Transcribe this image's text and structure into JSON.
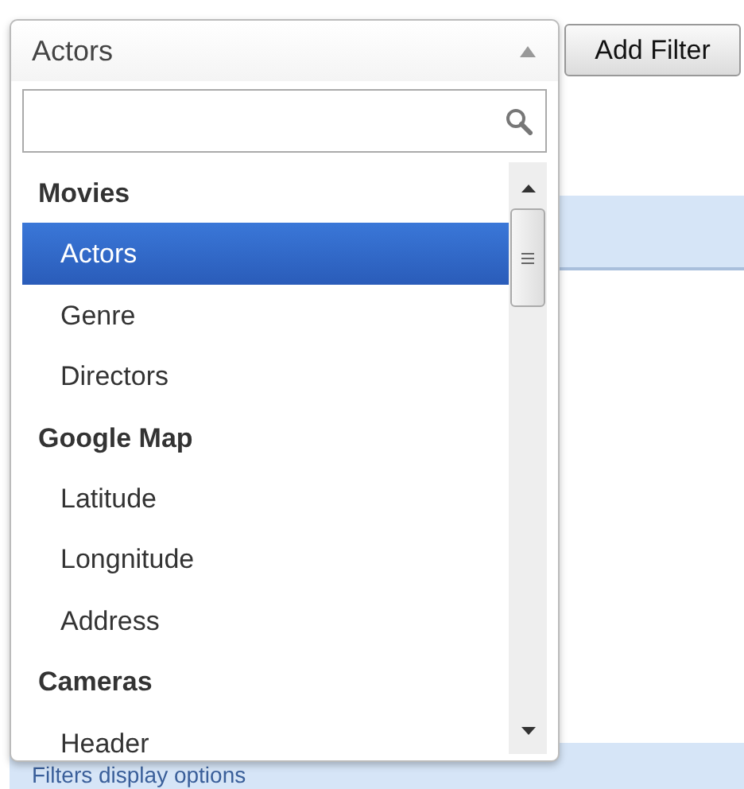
{
  "select": {
    "value": "Actors",
    "expanded": true
  },
  "add_filter_button": {
    "label": "Add Filter"
  },
  "groups": [
    {
      "label": "Movies",
      "options": [
        {
          "label": "Actors",
          "selected": true
        },
        {
          "label": "Genre",
          "selected": false
        },
        {
          "label": "Directors",
          "selected": false
        }
      ]
    },
    {
      "label": "Google Map",
      "options": [
        {
          "label": "Latitude",
          "selected": false
        },
        {
          "label": "Longnitude",
          "selected": false
        },
        {
          "label": "Address",
          "selected": false
        }
      ]
    },
    {
      "label": "Cameras",
      "options": [
        {
          "label": "Header",
          "selected": false
        }
      ]
    }
  ],
  "footer_bar": {
    "label": "Filters display options"
  }
}
